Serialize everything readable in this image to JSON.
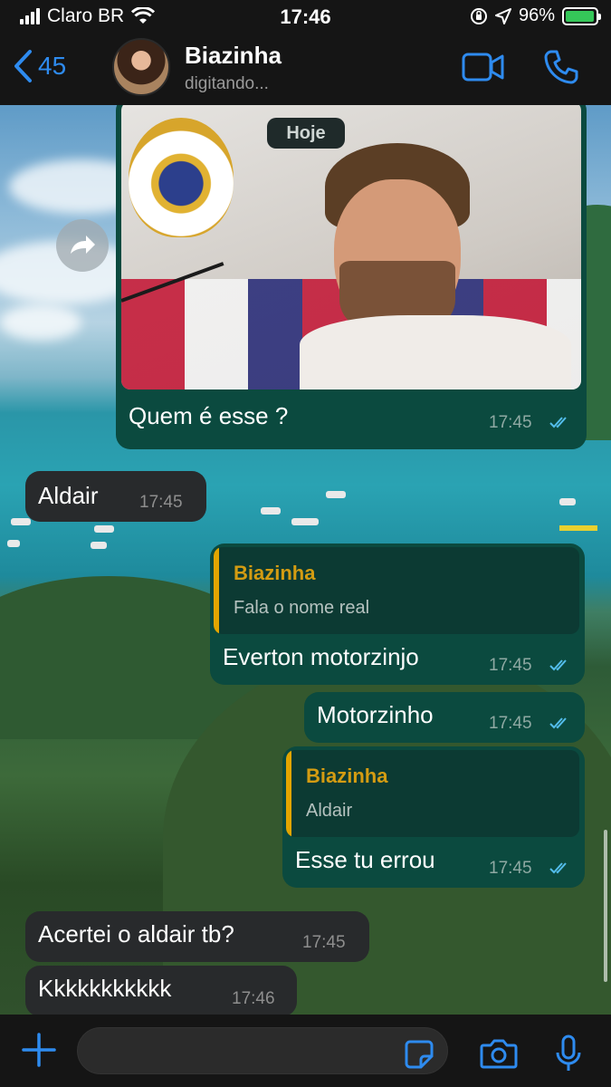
{
  "status_bar": {
    "carrier": "Claro BR",
    "time": "17:46",
    "battery": "96%",
    "battery_level": 0.96
  },
  "header": {
    "back_count": "45",
    "contact_name": "Biazinha",
    "contact_status": "digitando...",
    "video_icon": "video-camera-icon",
    "call_icon": "phone-icon"
  },
  "chat": {
    "date_label": "Hoje",
    "messages": [
      {
        "direction": "outgoing",
        "type": "image",
        "caption": "Quem é esse ?",
        "time": "17:45",
        "read": true
      },
      {
        "direction": "incoming",
        "text": "Aldair",
        "time": "17:45"
      },
      {
        "direction": "outgoing",
        "quote_author": "Biazinha",
        "quote_text": "Fala o nome real",
        "text": "Everton motorzinjo",
        "time": "17:45",
        "read": true
      },
      {
        "direction": "outgoing",
        "text": "Motorzinho",
        "time": "17:45",
        "read": true
      },
      {
        "direction": "outgoing",
        "quote_author": "Biazinha",
        "quote_text": "Aldair",
        "text": "Esse tu errou",
        "time": "17:45",
        "read": true
      },
      {
        "direction": "incoming",
        "text": "Acertei o aldair tb?",
        "time": "17:45"
      },
      {
        "direction": "incoming",
        "text": "Kkkkkkkkkkk",
        "time": "17:46"
      }
    ]
  },
  "input_bar": {
    "message_value": "",
    "icons": [
      "plus-icon",
      "sticker-icon",
      "camera-icon",
      "microphone-icon"
    ]
  },
  "colors": {
    "accent": "#2e8bef",
    "outgoing_bubble": "#0b4a3f",
    "incoming_bubble": "#282a2c",
    "quote_bar": "#e2a500",
    "read_ticks": "#53bdeb"
  }
}
